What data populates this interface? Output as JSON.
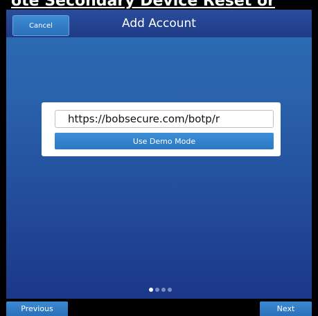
{
  "header_strip": {
    "text": "ote Secondary Device Reset or"
  },
  "navbar": {
    "title": "Add Account",
    "cancel_label": "Cancel"
  },
  "form": {
    "url_value": "https://bobsecure.com/botp/r",
    "demo_label": "Use Demo Mode"
  },
  "pager": {
    "total": 4,
    "active_index": 0
  },
  "footer": {
    "previous_label": "Previous",
    "next_label": "Next"
  },
  "colors": {
    "accent": "#2c78c4",
    "navbar": "#1f3b86",
    "background_top": "#2c6db4",
    "background_bottom": "#1c3788"
  }
}
